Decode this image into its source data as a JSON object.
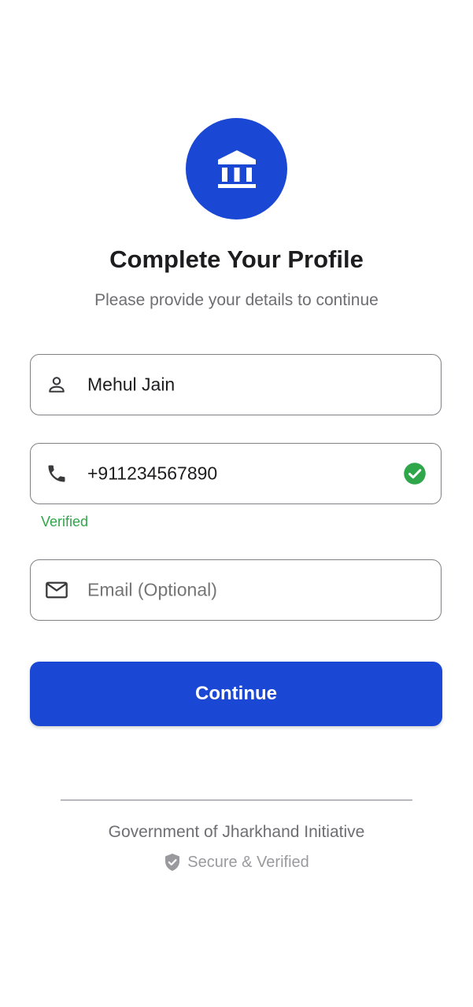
{
  "colors": {
    "brand_blue": "#1a47d3",
    "verified_green": "#2fa64a",
    "text_primary": "#1d1d1f",
    "text_secondary": "#6e6e73",
    "border": "#7f7f84"
  },
  "header": {
    "logo_icon": "bank-building-icon",
    "title": "Complete Your Profile",
    "subtitle": "Please provide your details to continue"
  },
  "form": {
    "name": {
      "icon": "person-icon",
      "value": "Mehul Jain"
    },
    "phone": {
      "icon": "phone-icon",
      "value": "+911234567890",
      "status_icon": "check-circle-icon",
      "status_text": "Verified"
    },
    "email": {
      "icon": "mail-icon",
      "placeholder": "Email (Optional)",
      "value": ""
    }
  },
  "actions": {
    "continue_label": "Continue"
  },
  "footer": {
    "initiative": "Government of Jharkhand Initiative",
    "secure_icon": "shield-check-icon",
    "secure_text": "Secure & Verified"
  }
}
